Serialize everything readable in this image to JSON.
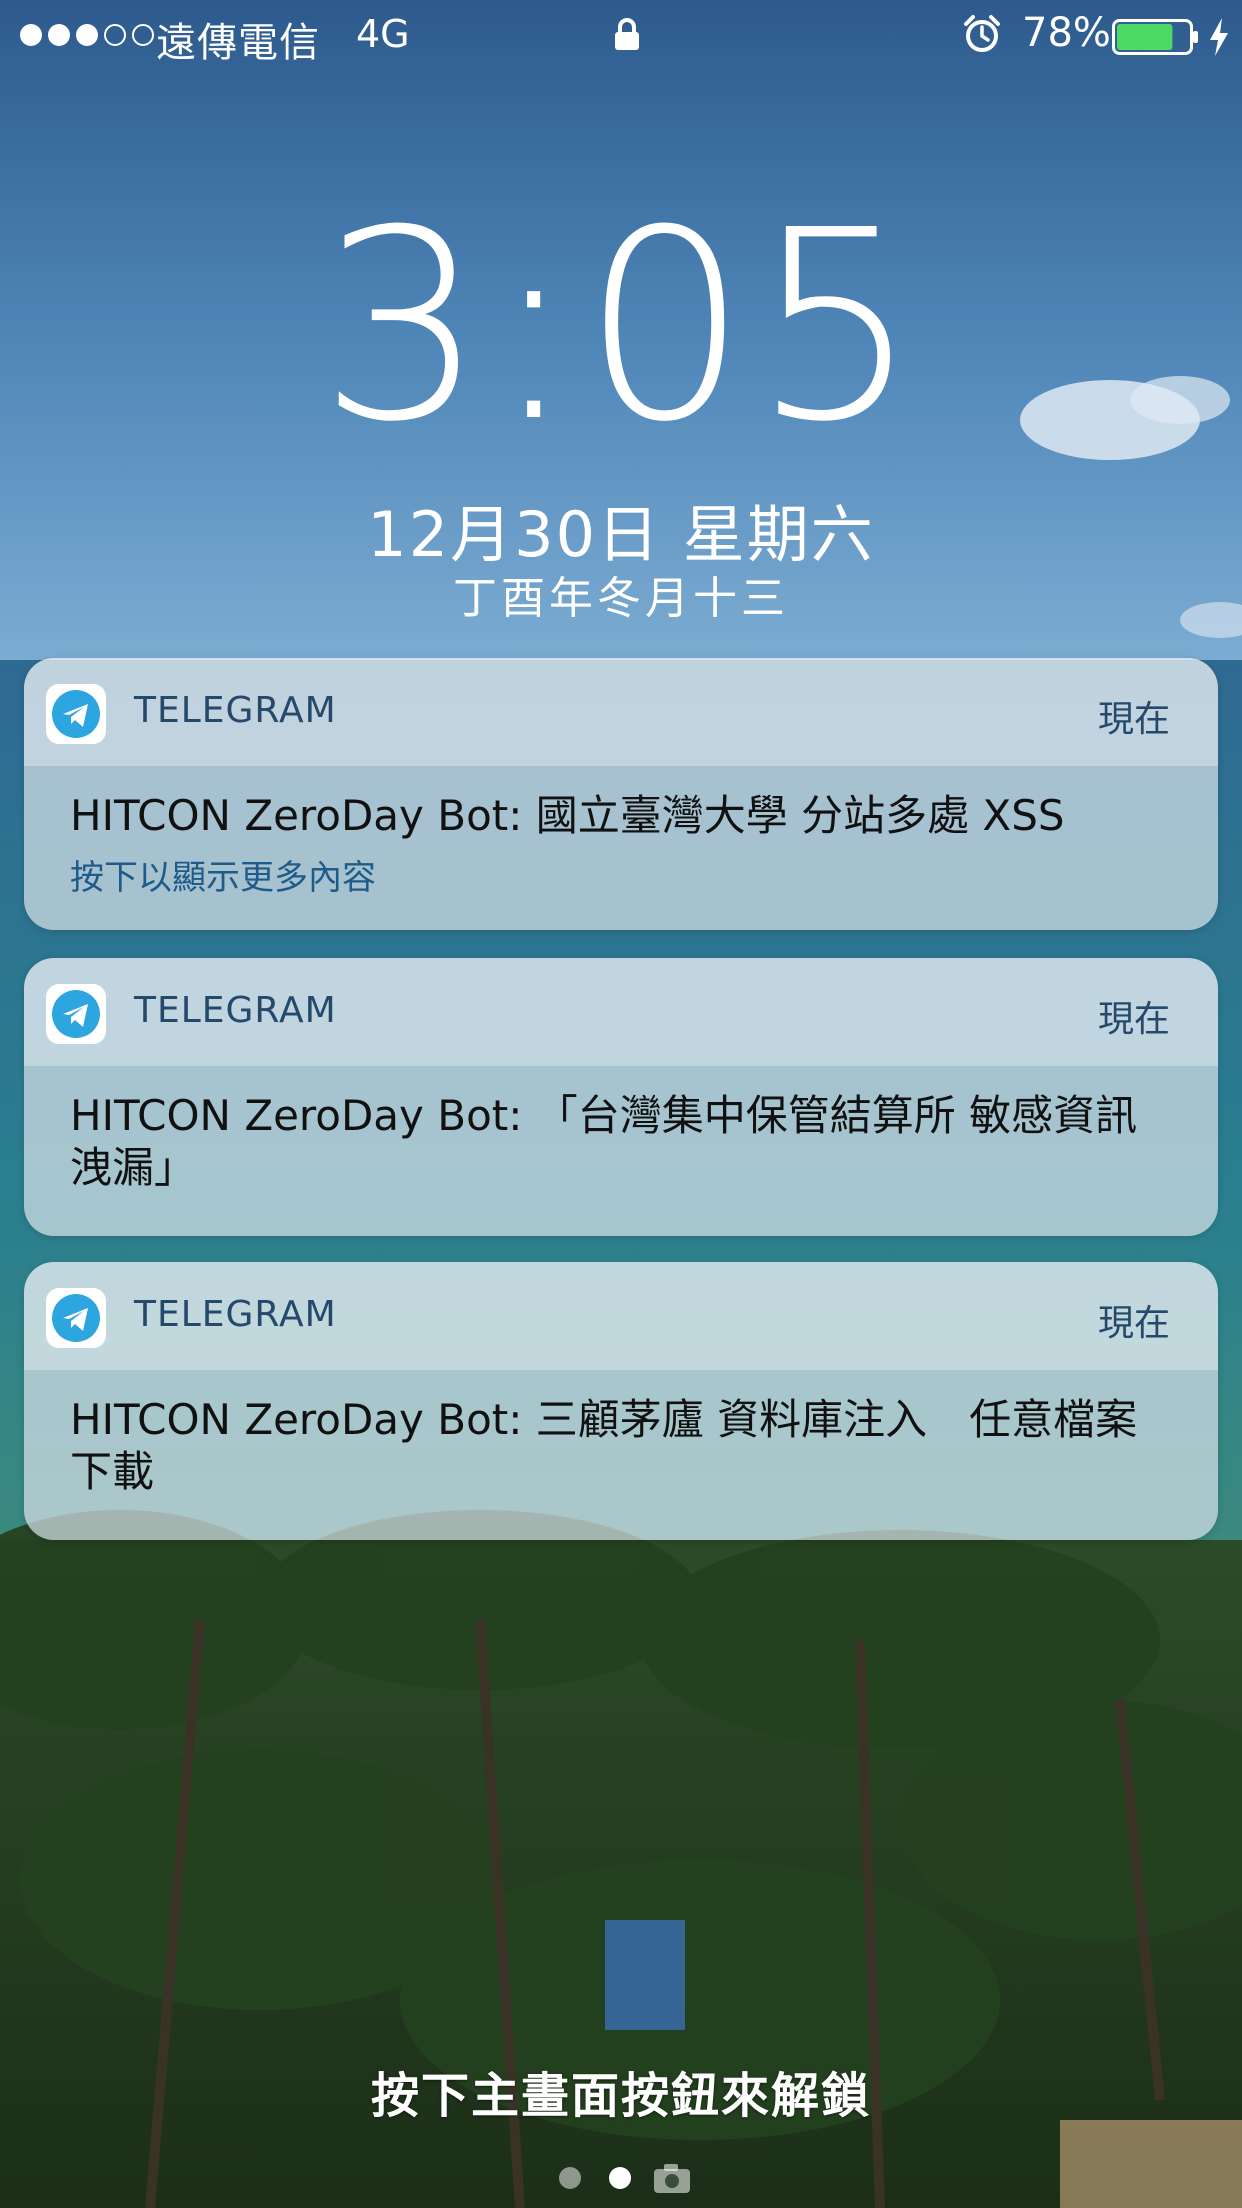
{
  "status_bar": {
    "signal_bars_full": 3,
    "signal_bars_total": 5,
    "carrier": "遠傳電信",
    "network": "4G",
    "battery_percent": "78%",
    "battery_level": 0.78,
    "battery_color": "#4cd964",
    "icons": [
      "lock-icon",
      "alarm-icon",
      "battery-icon",
      "charging-bolt-icon"
    ]
  },
  "lock_screen": {
    "time": "3:05",
    "date": "12月30日 星期六",
    "lunar_date": "丁酉年冬月十三",
    "unlock_hint": "按下主畫面按鈕來解鎖"
  },
  "notifications": [
    {
      "app": "TELEGRAM",
      "time": "現在",
      "message": "HITCON ZeroDay Bot: 國立臺灣大學 分站多處 XSS",
      "hint": "按下以顯示更多內容"
    },
    {
      "app": "TELEGRAM",
      "time": "現在",
      "message": "HITCON ZeroDay Bot: 「台灣集中保管結算所 敏感資訊洩漏」"
    },
    {
      "app": "TELEGRAM",
      "time": "現在",
      "message": "HITCON ZeroDay Bot: 三顧茅廬 資料庫注入　任意檔案下載"
    }
  ],
  "pager": {
    "pages": 3,
    "current_page": 2,
    "last_page_icon": "camera-icon"
  },
  "colors": {
    "telegram_blue": "#2ca5e0",
    "notification_text": "#24496a"
  }
}
